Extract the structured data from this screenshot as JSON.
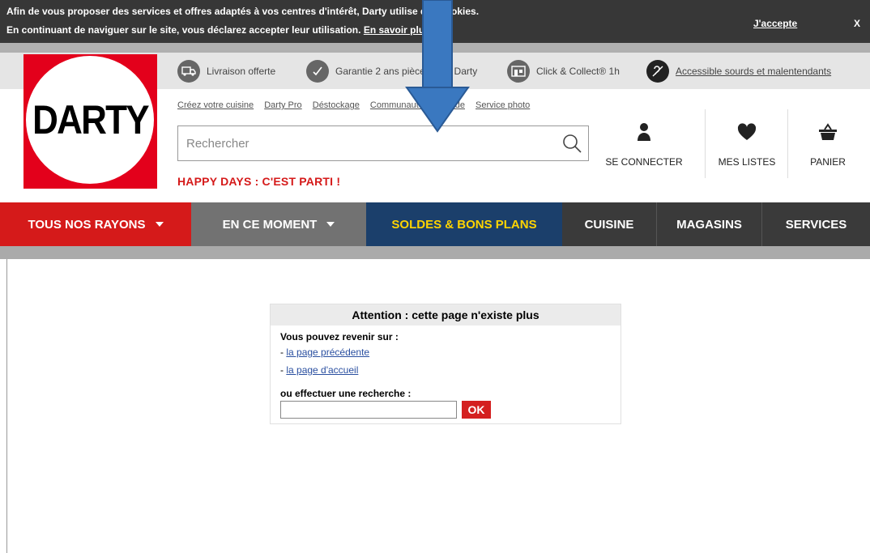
{
  "cookie": {
    "line1": "Afin de vous proposer des services et offres adaptés à vos centres d'intérêt, Darty utilise des cookies.",
    "line2": "En continuant de naviguer sur le site, vous déclarez accepter leur utilisation.",
    "more_link": "En savoir plus",
    "accept": "J'accepte",
    "close": "X"
  },
  "logo": {
    "text": "DARTY"
  },
  "usp": [
    {
      "label": "Livraison offerte",
      "icon": "truck-icon"
    },
    {
      "label": "Garantie 2 ans pièces SAV Darty",
      "icon": "check-icon"
    },
    {
      "label": "Click & Collect® 1h",
      "icon": "store-icon"
    },
    {
      "label": "Accessible sourds et malentendants",
      "icon": "ear-icon"
    }
  ],
  "sublinks": [
    "Créez votre cuisine",
    "Darty Pro",
    "Déstockage",
    "Communauté d'entraide",
    "Service photo"
  ],
  "search": {
    "placeholder": "Rechercher"
  },
  "promo": "HAPPY DAYS : C'EST PARTI !",
  "header_buttons": {
    "connect": "SE CONNECTER",
    "lists": "MES LISTES",
    "cart": "PANIER"
  },
  "nav": {
    "items": [
      {
        "label": "TOUS NOS RAYONS",
        "bg": "#d51a1a",
        "has_caret": true
      },
      {
        "label": "EN CE MOMENT",
        "bg": "#727272",
        "has_caret": true
      },
      {
        "label": "SOLDES & BONS PLANS",
        "bg": "#1b3f6b",
        "color": "#ffd400",
        "has_caret": false
      },
      {
        "label": "CUISINE",
        "bg": "#3a3a3a",
        "has_caret": false
      },
      {
        "label": "MAGASINS",
        "bg": "#3a3a3a",
        "has_caret": false
      },
      {
        "label": "SERVICES",
        "bg": "#3a3a3a",
        "has_caret": false
      }
    ]
  },
  "error_box": {
    "title": "Attention : cette page n'existe plus",
    "intro": "Vous pouvez revenir sur :",
    "link_prefix": "- ",
    "link_prev": "la page précédente",
    "link_home": "la page d'accueil",
    "search_label": "ou effectuer une recherche :",
    "ok": "OK"
  },
  "colors": {
    "brand_red": "#e3001b",
    "nav_blue": "#1b3f6b",
    "arrow_blue": "#3a78c0"
  }
}
